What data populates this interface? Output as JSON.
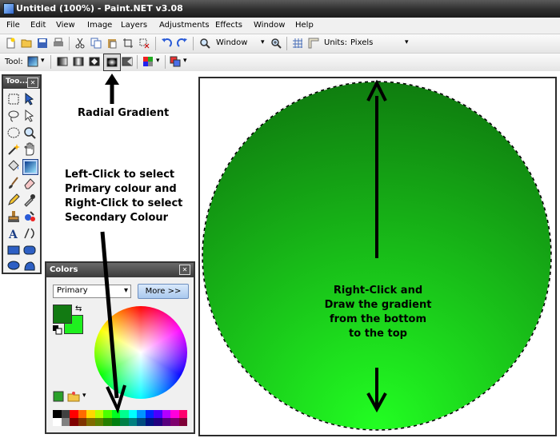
{
  "window": {
    "title": "Untitled (100%) - Paint.NET v3.08"
  },
  "menu": [
    "File",
    "Edit",
    "View",
    "Image",
    "Layers",
    "Adjustments",
    "Effects",
    "Window",
    "Help"
  ],
  "toolbar": {
    "zoom_value": "Window",
    "units_label": "Units:",
    "units_value": "Pixels",
    "tool_label": "Tool:"
  },
  "tools_window": {
    "title": "Too..."
  },
  "colors_window": {
    "title": "Colors",
    "mode_select": "Primary",
    "more_button": "More >>",
    "primary_color": "#127a12",
    "secondary_color": "#1fef1f"
  },
  "palette": [
    "#000000",
    "#404040",
    "#ff0000",
    "#ff6a00",
    "#ffd800",
    "#b6ff00",
    "#4cff00",
    "#00ff21",
    "#00ff90",
    "#00ffff",
    "#0094ff",
    "#0026ff",
    "#4800ff",
    "#b200ff",
    "#ff00dc",
    "#ff006e",
    "#ffffff",
    "#808080",
    "#7f0000",
    "#7f3300",
    "#7f6a00",
    "#5b7f00",
    "#267f00",
    "#007f0e",
    "#007f46",
    "#007f7f",
    "#004a7f",
    "#00137f",
    "#21007f",
    "#57007f",
    "#7f006e",
    "#7f0037"
  ],
  "annotations": {
    "radial": "Radial Gradient",
    "left_click": [
      "Left-Click to select",
      "Primary colour and",
      "Right-Click to select",
      "Secondary Colour"
    ],
    "draw": [
      "Right-Click and",
      "Draw the gradient",
      "from the bottom",
      "to the top"
    ]
  },
  "gradient": {
    "outer_color": "#0f7d0f",
    "center_color": "#22ff22"
  }
}
